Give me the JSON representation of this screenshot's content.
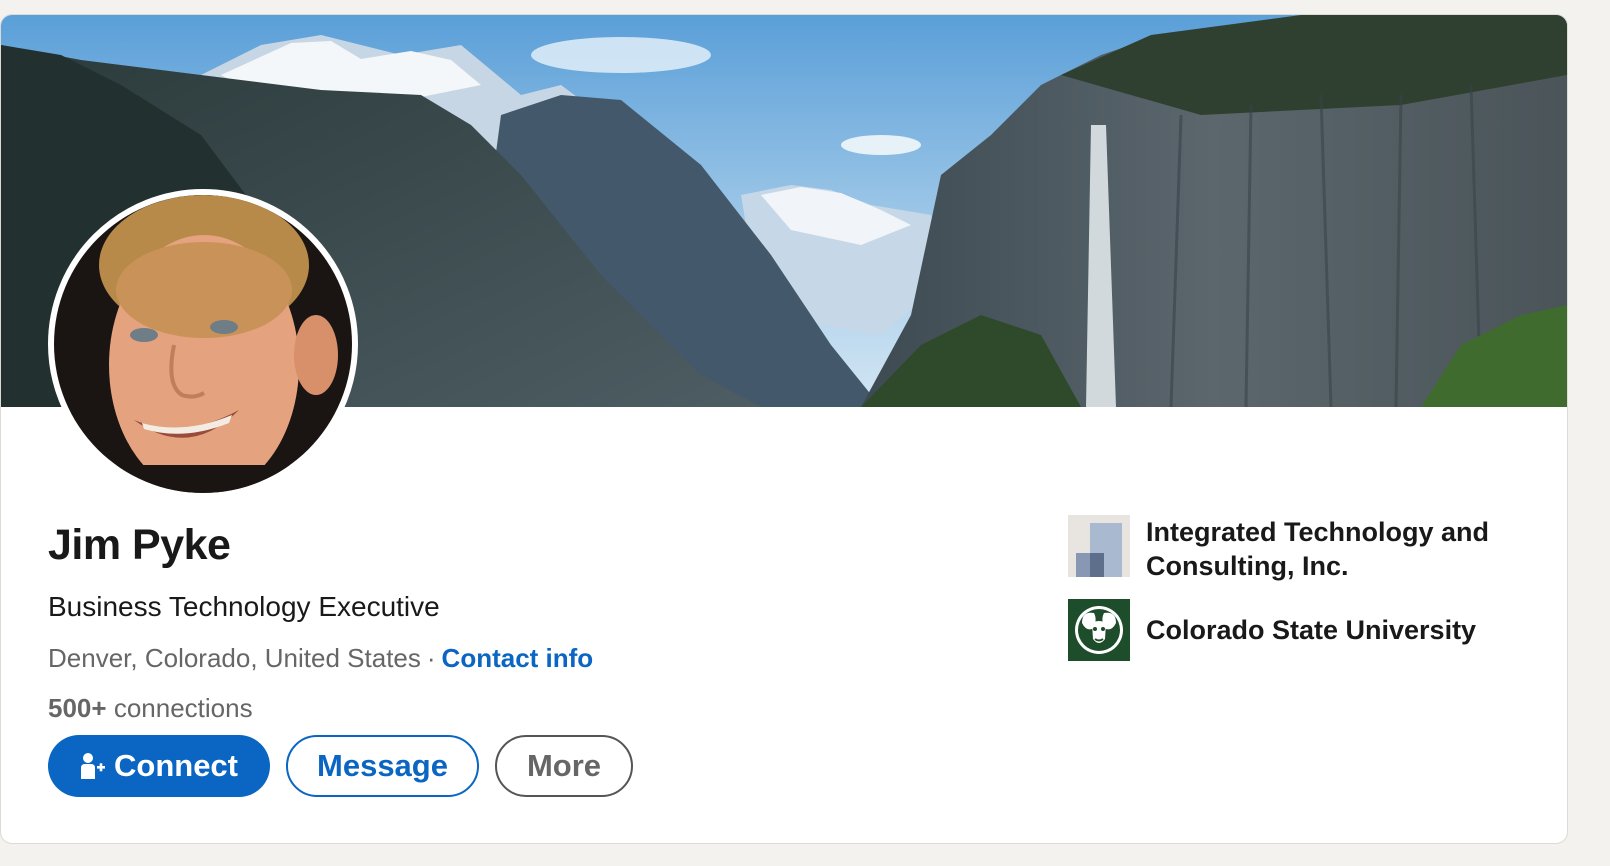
{
  "profile": {
    "name": "Jim Pyke",
    "headline": "Business Technology Executive",
    "location": "Denver, Colorado, United States",
    "separator": "·",
    "contact_info_label": "Contact info",
    "connections_count": "500+",
    "connections_label": "connections"
  },
  "actions": {
    "connect_label": "Connect",
    "message_label": "Message",
    "more_label": "More"
  },
  "organizations": [
    {
      "name": "Integrated Technology and Consulting, Inc.",
      "logo_icon": "company-logo-icon"
    },
    {
      "name": "Colorado State University",
      "logo_icon": "ram-logo-icon"
    }
  ],
  "colors": {
    "accent": "#0a66c2",
    "text_primary": "#191919",
    "text_secondary": "#666666",
    "csu_green": "#1e4d2b"
  }
}
